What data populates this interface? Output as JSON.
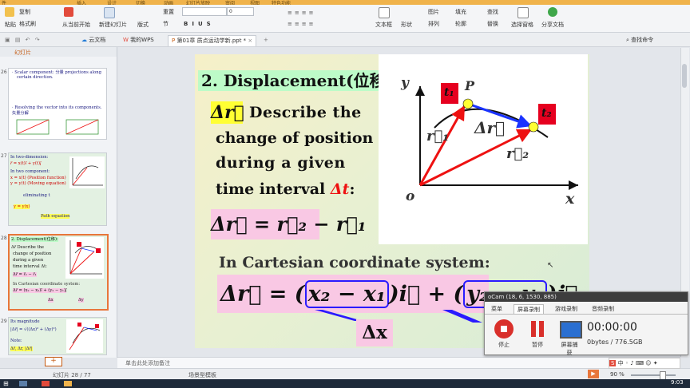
{
  "top_strip": [
    "件",
    "插入",
    "设计",
    "切换",
    "动画",
    "幻灯片放映",
    "审阅",
    "视图",
    "特色功能"
  ],
  "ribbon": {
    "paste": "粘贴",
    "copy": "复制",
    "format_painter": "格式刷",
    "from_current": "从当前开始",
    "new_slide": "新建幻灯片",
    "layout": "版式",
    "reset": "重置",
    "section": "节",
    "font_size": "0",
    "text_box": "文本框",
    "shape": "形状",
    "arrange": "排列",
    "picture": "图片",
    "fill": "填充",
    "outline": "轮廓",
    "find": "查找",
    "replace": "替换",
    "select_pane": "选择窗格",
    "share_doc": "分享文档",
    "search_cmd": "查找命令"
  },
  "tabs": {
    "cloud_docs": "云文档",
    "my_wps": "我的WPS",
    "active_doc": "第01章 质点运动学新.ppt *"
  },
  "left_panel": {
    "header": "幻灯片",
    "thumb1": {
      "num": "26",
      "lines": [
        "· Scalar component: 分量 projections along",
        "certain direction.",
        "· Resolving the vector into its components.",
        "矢量分解"
      ]
    },
    "thumb2": {
      "num": "27",
      "lines": [
        "In two-dimension:",
        "r⃗ = x(t)i⃗ + y(t)j⃗",
        "In two component:",
        "x = x(t)  (Position function)",
        "y = y(t)  (Moving equation)",
        "eliminating t",
        "y = y(x)",
        "Path equation"
      ]
    },
    "thumb3": {
      "num": "28",
      "lines": [
        "2. Displacement(位移):",
        "Δr⃗  Describe the",
        "change of position",
        "during a given",
        "time interval Δt:",
        "Δr⃗ = r⃗₂ − r⃗₁",
        "In Cartesian coordinate system:",
        "Δr⃗ = (x₂ − x₁)i⃗ + (y₂ − y₁)j⃗",
        "Δx",
        "Δy"
      ]
    },
    "thumb4": {
      "num": "29",
      "lines": [
        "Its magnitude",
        "|Δr⃗| = √((Δx)² + (Δy)²)",
        "Note:",
        "Δr⃗, Δr, |Δr⃗|"
      ]
    }
  },
  "slide": {
    "heading": "2. Displacement(位移):",
    "delta_r": "Δr⃗",
    "desc_line1": "Describe the",
    "desc_line2": "change of position",
    "desc_line3": "during  a  given",
    "desc_line4_a": "time interval ",
    "desc_line4_dt": "Δt",
    "desc_line4_b": ":",
    "eq1": "Δr⃗ = r⃗₂ − r⃗₁",
    "cartesian_label": "In Cartesian coordinate system:",
    "eq2_lhs": "Δr⃗ = (",
    "eq2_x": "x₂ − x₁",
    "eq2_mid": ")i⃗ + (",
    "eq2_y": "y₂ − y₁",
    "eq2_rhs": ")j⃗",
    "dx_label": "Δx",
    "diagram": {
      "y_axis": "y",
      "x_axis": "x",
      "origin": "o",
      "t1": "t₁",
      "t2": "t₂",
      "point_p": "P",
      "r1": "r⃗₁",
      "r2": "r⃗₂",
      "dr": "Δr⃗"
    }
  },
  "notes_placeholder": "单击此处添加备注",
  "status": {
    "slide_counter": "幻灯片 28 / 77",
    "template": "场景型模板",
    "zoom": "90 %"
  },
  "taskbar": {
    "clock": "9:03"
  },
  "ocam": {
    "title": "oCam (18, 6, 1530, 885)",
    "tabs": [
      "菜单",
      "屏幕录制",
      "游戏录制",
      "音频录制"
    ],
    "buttons": [
      "停止",
      "暂停",
      "屏幕捕获"
    ],
    "timer": "00:00:00",
    "storage": "0bytes / 776.5GB"
  },
  "colors": {
    "accent_orange": "#f0b34b",
    "slide_highlight_yellow": "#ffff33",
    "slide_highlight_pink": "#f9c8e4",
    "heading_bg": "#bdfbc8",
    "arrow_red": "#e11",
    "arrow_blue": "#1a33ff",
    "box_red": "#e6001f"
  }
}
